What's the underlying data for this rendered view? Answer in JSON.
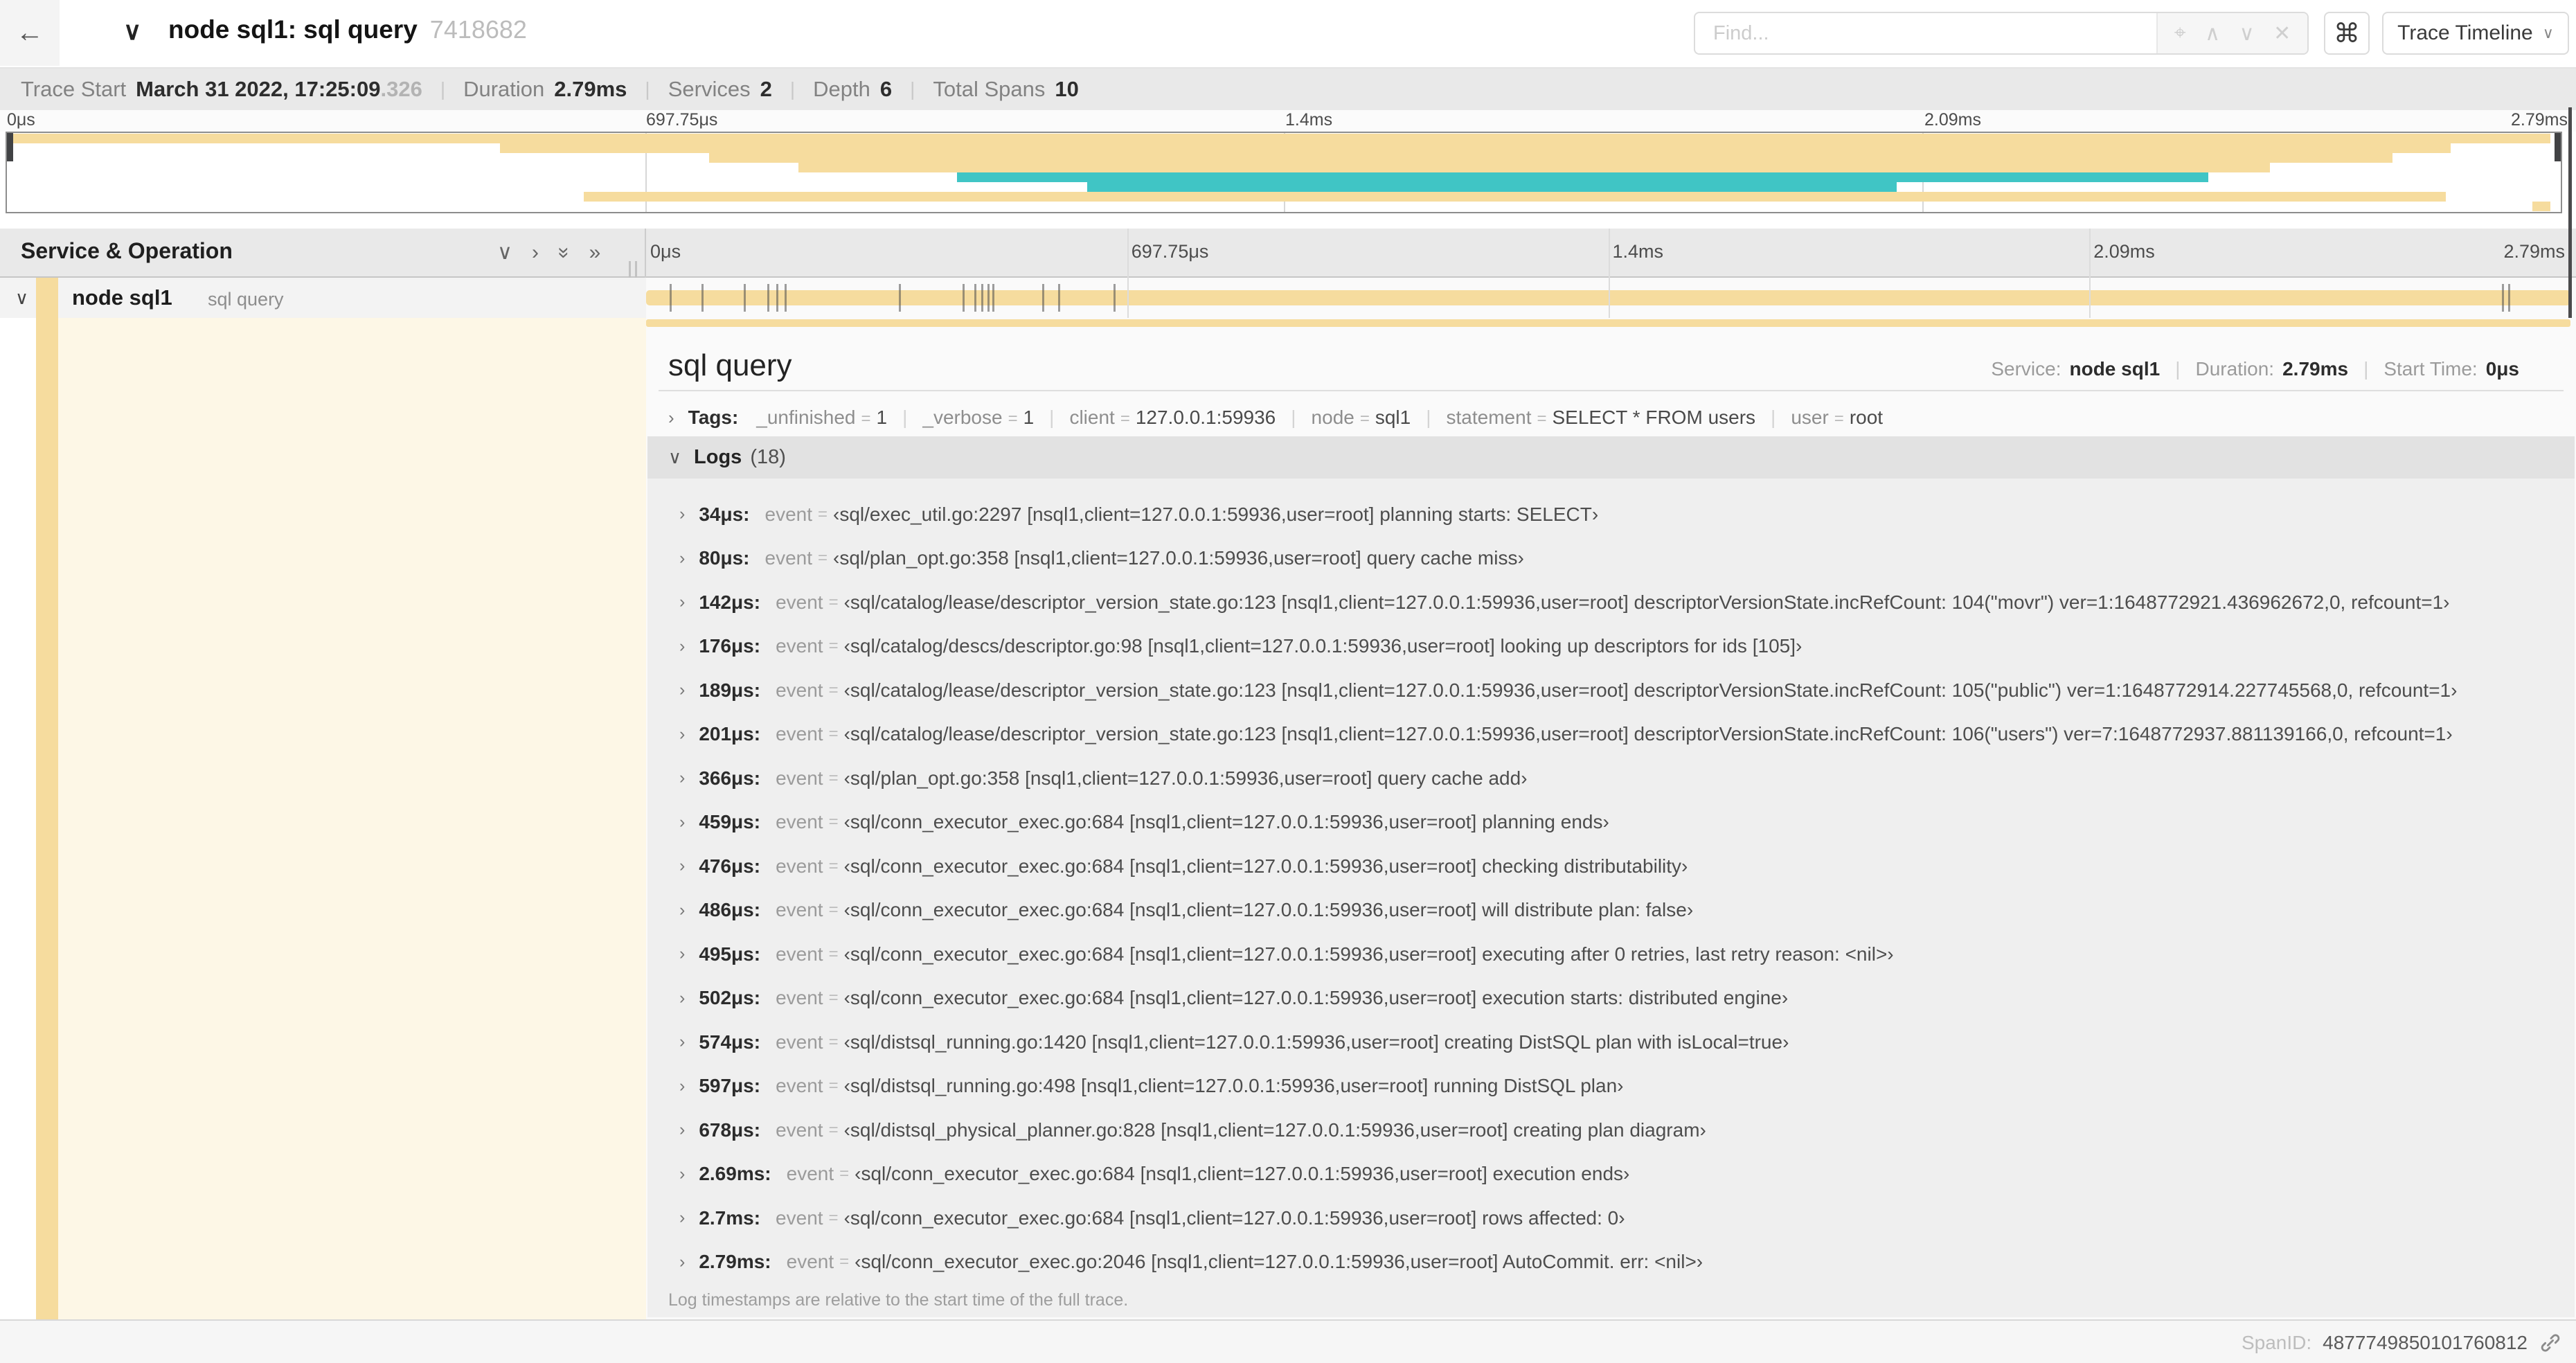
{
  "colors": {
    "span_tan": "#F6DC9E",
    "span_teal": "#40C5C5",
    "detail_cream": "#FDF7E6"
  },
  "header": {
    "back_icon": "←",
    "collapse_icon": "∨",
    "title": "node sql1: sql query",
    "trace_id": "7418682",
    "find_placeholder": "Find...",
    "find_icons": [
      {
        "name": "match-locate-icon",
        "glyph": "⌖"
      },
      {
        "name": "prev-match-icon",
        "glyph": "∧"
      },
      {
        "name": "next-match-icon",
        "glyph": "∨"
      },
      {
        "name": "clear-search-icon",
        "glyph": "✕"
      }
    ],
    "shortcut_icon": "⌘",
    "view_selector": "Trace Timeline",
    "view_chevron": "∨"
  },
  "trace_info": [
    {
      "label": "Trace Start",
      "value": "March 31 2022, 17:25:09",
      "muted": ".326"
    },
    {
      "label": "Duration",
      "value": "2.79ms"
    },
    {
      "label": "Services",
      "value": "2"
    },
    {
      "label": "Depth",
      "value": "6"
    },
    {
      "label": "Total Spans",
      "value": "10"
    }
  ],
  "minimap": {
    "labels": [
      {
        "text": "0μs",
        "pct": 0,
        "align": "left"
      },
      {
        "text": "697.75μs",
        "pct": 25,
        "align": "left"
      },
      {
        "text": "1.4ms",
        "pct": 50,
        "align": "left"
      },
      {
        "text": "2.09ms",
        "pct": 75,
        "align": "left"
      },
      {
        "text": "2.79ms",
        "pct": 100,
        "align": "right"
      }
    ],
    "spans": [
      {
        "row": 0,
        "start_pct": 0.2,
        "end_pct": 99.6,
        "color": "tan"
      },
      {
        "row": 1,
        "start_pct": 19.3,
        "end_pct": 95.7,
        "color": "tan"
      },
      {
        "row": 2,
        "start_pct": 27.5,
        "end_pct": 93.4,
        "color": "tan"
      },
      {
        "row": 3,
        "start_pct": 31.0,
        "end_pct": 88.6,
        "color": "tan"
      },
      {
        "row": 4,
        "start_pct": 37.2,
        "end_pct": 86.2,
        "color": "teal"
      },
      {
        "row": 5,
        "start_pct": 42.3,
        "end_pct": 74.0,
        "color": "teal"
      },
      {
        "row": 6,
        "start_pct": 22.6,
        "end_pct": 95.5,
        "color": "tan"
      },
      {
        "row": 7,
        "start_pct": 98.9,
        "end_pct": 99.6,
        "color": "tan"
      }
    ]
  },
  "timeline_header": {
    "title": "Service & Operation",
    "icons": [
      {
        "name": "collapse-one-icon",
        "glyph": "∨",
        "rot": false
      },
      {
        "name": "expand-one-icon",
        "glyph": "›",
        "rot": false
      },
      {
        "name": "collapse-all-icon",
        "glyph": "»",
        "rot": true
      },
      {
        "name": "expand-all-icon",
        "glyph": "»",
        "rot": false
      }
    ],
    "ruler_labels": [
      {
        "text": "0μs",
        "pct": 0,
        "align": "left"
      },
      {
        "text": "697.75μs",
        "pct": 25,
        "align": "left"
      },
      {
        "text": "1.4ms",
        "pct": 50,
        "align": "left"
      },
      {
        "text": "2.09ms",
        "pct": 75,
        "align": "left"
      },
      {
        "text": "2.79ms",
        "pct": 100,
        "align": "right"
      }
    ]
  },
  "span_row": {
    "chevron": "∨",
    "service": "node sql1",
    "operation": "sql query",
    "tick_pcts": [
      1.22,
      2.87,
      5.09,
      6.31,
      6.77,
      7.2,
      13.12,
      16.45,
      17.06,
      17.42,
      17.74,
      18.0,
      20.57,
      21.4,
      24.3,
      96.42,
      96.77,
      99.9
    ]
  },
  "detail": {
    "title": "sql query",
    "meta": [
      {
        "label": "Service:",
        "value": "node sql1"
      },
      {
        "label": "Duration:",
        "value": "2.79ms"
      },
      {
        "label": "Start Time:",
        "value": "0μs"
      }
    ],
    "tags_chevron": "›",
    "tags_label": "Tags:",
    "tags": [
      {
        "key": "_unfinished",
        "value": "1"
      },
      {
        "key": "_verbose",
        "value": "1"
      },
      {
        "key": "client",
        "value": "127.0.0.1:59936"
      },
      {
        "key": "node",
        "value": "sql1"
      },
      {
        "key": "statement",
        "value": "SELECT * FROM users"
      },
      {
        "key": "user",
        "value": "root"
      }
    ],
    "logs_chevron": "∨",
    "logs_label": "Logs",
    "logs_count": "(18)",
    "log_field": "event",
    "logs": [
      {
        "time": "34μs:",
        "value": "‹sql/exec_util.go:2297 [nsql1,client=127.0.0.1:59936,user=root] planning starts: SELECT›"
      },
      {
        "time": "80μs:",
        "value": "‹sql/plan_opt.go:358 [nsql1,client=127.0.0.1:59936,user=root] query cache miss›"
      },
      {
        "time": "142μs:",
        "value": "‹sql/catalog/lease/descriptor_version_state.go:123 [nsql1,client=127.0.0.1:59936,user=root] descriptorVersionState.incRefCount: 104(\"movr\") ver=1:1648772921.436962672,0, refcount=1›"
      },
      {
        "time": "176μs:",
        "value": "‹sql/catalog/descs/descriptor.go:98 [nsql1,client=127.0.0.1:59936,user=root] looking up descriptors for ids [105]›"
      },
      {
        "time": "189μs:",
        "value": "‹sql/catalog/lease/descriptor_version_state.go:123 [nsql1,client=127.0.0.1:59936,user=root] descriptorVersionState.incRefCount: 105(\"public\") ver=1:1648772914.227745568,0, refcount=1›"
      },
      {
        "time": "201μs:",
        "value": "‹sql/catalog/lease/descriptor_version_state.go:123 [nsql1,client=127.0.0.1:59936,user=root] descriptorVersionState.incRefCount: 106(\"users\") ver=7:1648772937.881139166,0, refcount=1›"
      },
      {
        "time": "366μs:",
        "value": "‹sql/plan_opt.go:358 [nsql1,client=127.0.0.1:59936,user=root] query cache add›"
      },
      {
        "time": "459μs:",
        "value": "‹sql/conn_executor_exec.go:684 [nsql1,client=127.0.0.1:59936,user=root] planning ends›"
      },
      {
        "time": "476μs:",
        "value": "‹sql/conn_executor_exec.go:684 [nsql1,client=127.0.0.1:59936,user=root] checking distributability›"
      },
      {
        "time": "486μs:",
        "value": "‹sql/conn_executor_exec.go:684 [nsql1,client=127.0.0.1:59936,user=root] will distribute plan: false›"
      },
      {
        "time": "495μs:",
        "value": "‹sql/conn_executor_exec.go:684 [nsql1,client=127.0.0.1:59936,user=root] executing after 0 retries, last retry reason: <nil>›"
      },
      {
        "time": "502μs:",
        "value": "‹sql/conn_executor_exec.go:684 [nsql1,client=127.0.0.1:59936,user=root] execution starts: distributed engine›"
      },
      {
        "time": "574μs:",
        "value": "‹sql/distsql_running.go:1420 [nsql1,client=127.0.0.1:59936,user=root] creating DistSQL plan with isLocal=true›"
      },
      {
        "time": "597μs:",
        "value": "‹sql/distsql_running.go:498 [nsql1,client=127.0.0.1:59936,user=root] running DistSQL plan›"
      },
      {
        "time": "678μs:",
        "value": "‹sql/distsql_physical_planner.go:828 [nsql1,client=127.0.0.1:59936,user=root] creating plan diagram›"
      },
      {
        "time": "2.69ms:",
        "value": "‹sql/conn_executor_exec.go:684 [nsql1,client=127.0.0.1:59936,user=root] execution ends›"
      },
      {
        "time": "2.7ms:",
        "value": "‹sql/conn_executor_exec.go:684 [nsql1,client=127.0.0.1:59936,user=root] rows affected: 0›"
      },
      {
        "time": "2.79ms:",
        "value": "‹sql/conn_executor_exec.go:2046 [nsql1,client=127.0.0.1:59936,user=root] AutoCommit. err: <nil>›"
      }
    ],
    "note": "Log timestamps are relative to the start time of the full trace.",
    "span_id_label": "SpanID:",
    "span_id": "4877749850101760812"
  }
}
